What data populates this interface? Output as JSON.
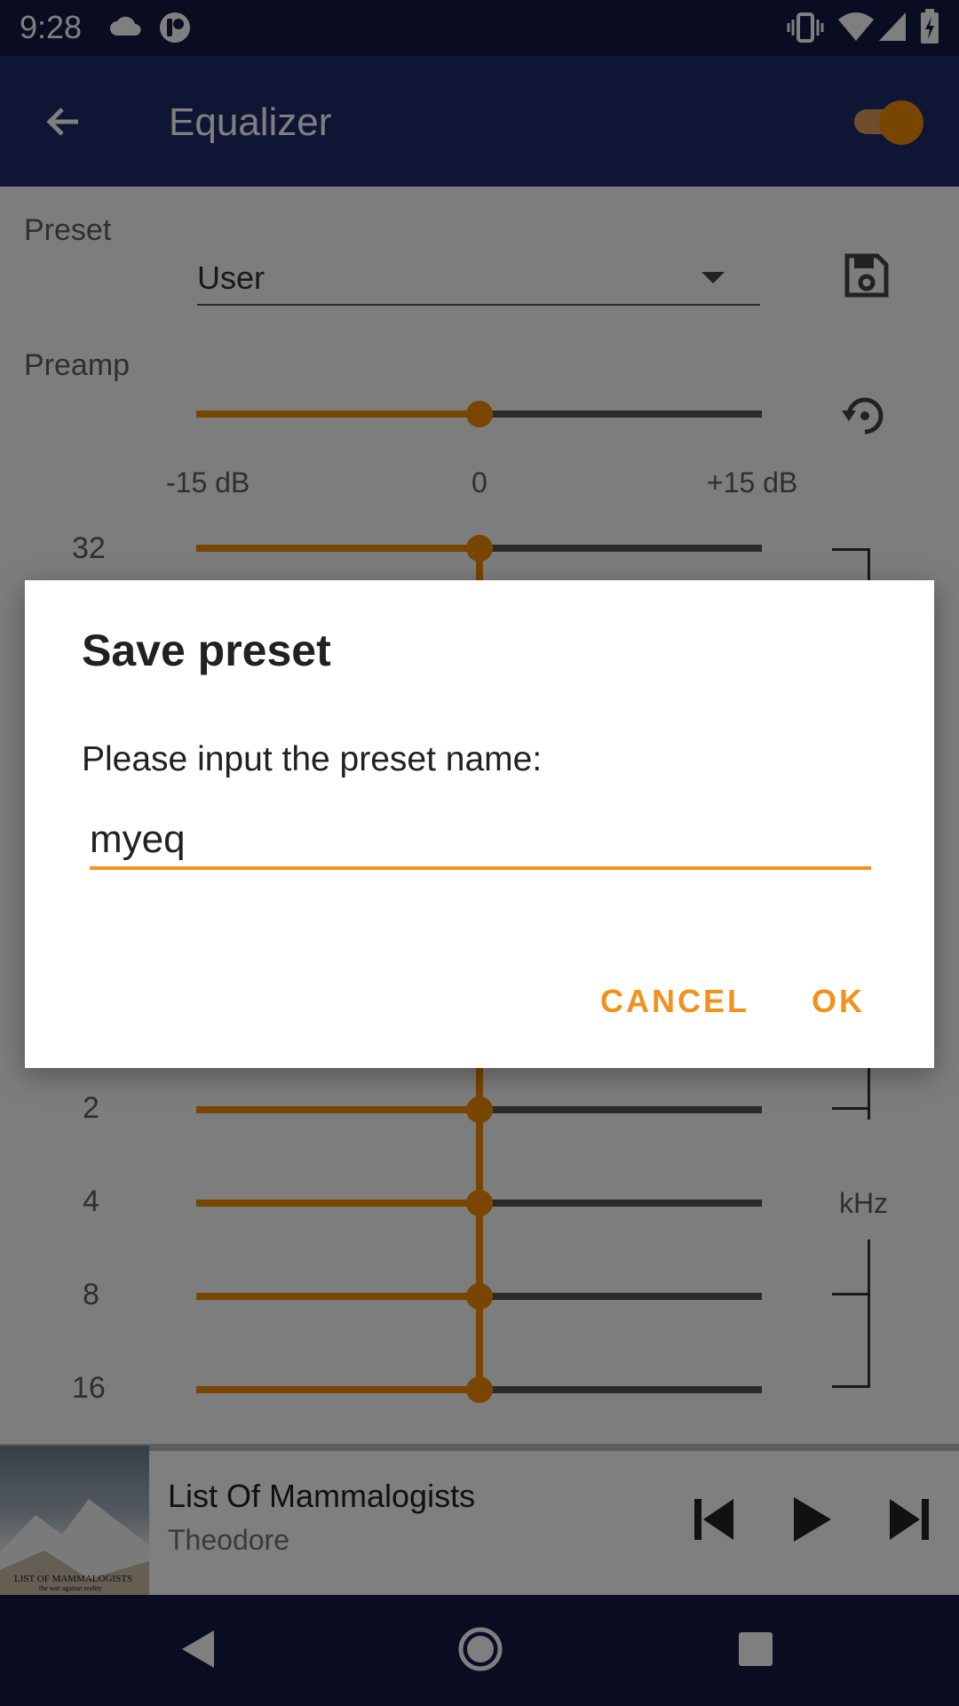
{
  "status": {
    "time": "9:28"
  },
  "appbar": {
    "title": "Equalizer",
    "eq_enabled": true
  },
  "preset": {
    "label": "Preset",
    "selected": "User"
  },
  "preamp": {
    "label": "Preamp",
    "min_label": "-15 dB",
    "center_label": "0",
    "max_label": "+15 dB",
    "value_db": 0
  },
  "bands": {
    "top_label": "32",
    "visible": [
      {
        "label": "2",
        "value_db": 0
      },
      {
        "label": "4",
        "value_db": 0
      },
      {
        "label": "8",
        "value_db": 0
      },
      {
        "label": "16",
        "value_db": 0
      }
    ],
    "unit_label": "kHz"
  },
  "player": {
    "track": "List Of Mammalogists",
    "artist": "Theodore",
    "album_art_caption": "LIST OF MAMMALOGISTS",
    "album_art_subcaption": "the war against reality"
  },
  "dialog": {
    "title": "Save preset",
    "message": "Please input the preset name:",
    "input_value": "myeq",
    "cancel_label": "CANCEL",
    "ok_label": "OK"
  },
  "colors": {
    "accent": "#f0921b",
    "primary": "#1f2a6a",
    "status_bar": "#151b45"
  }
}
